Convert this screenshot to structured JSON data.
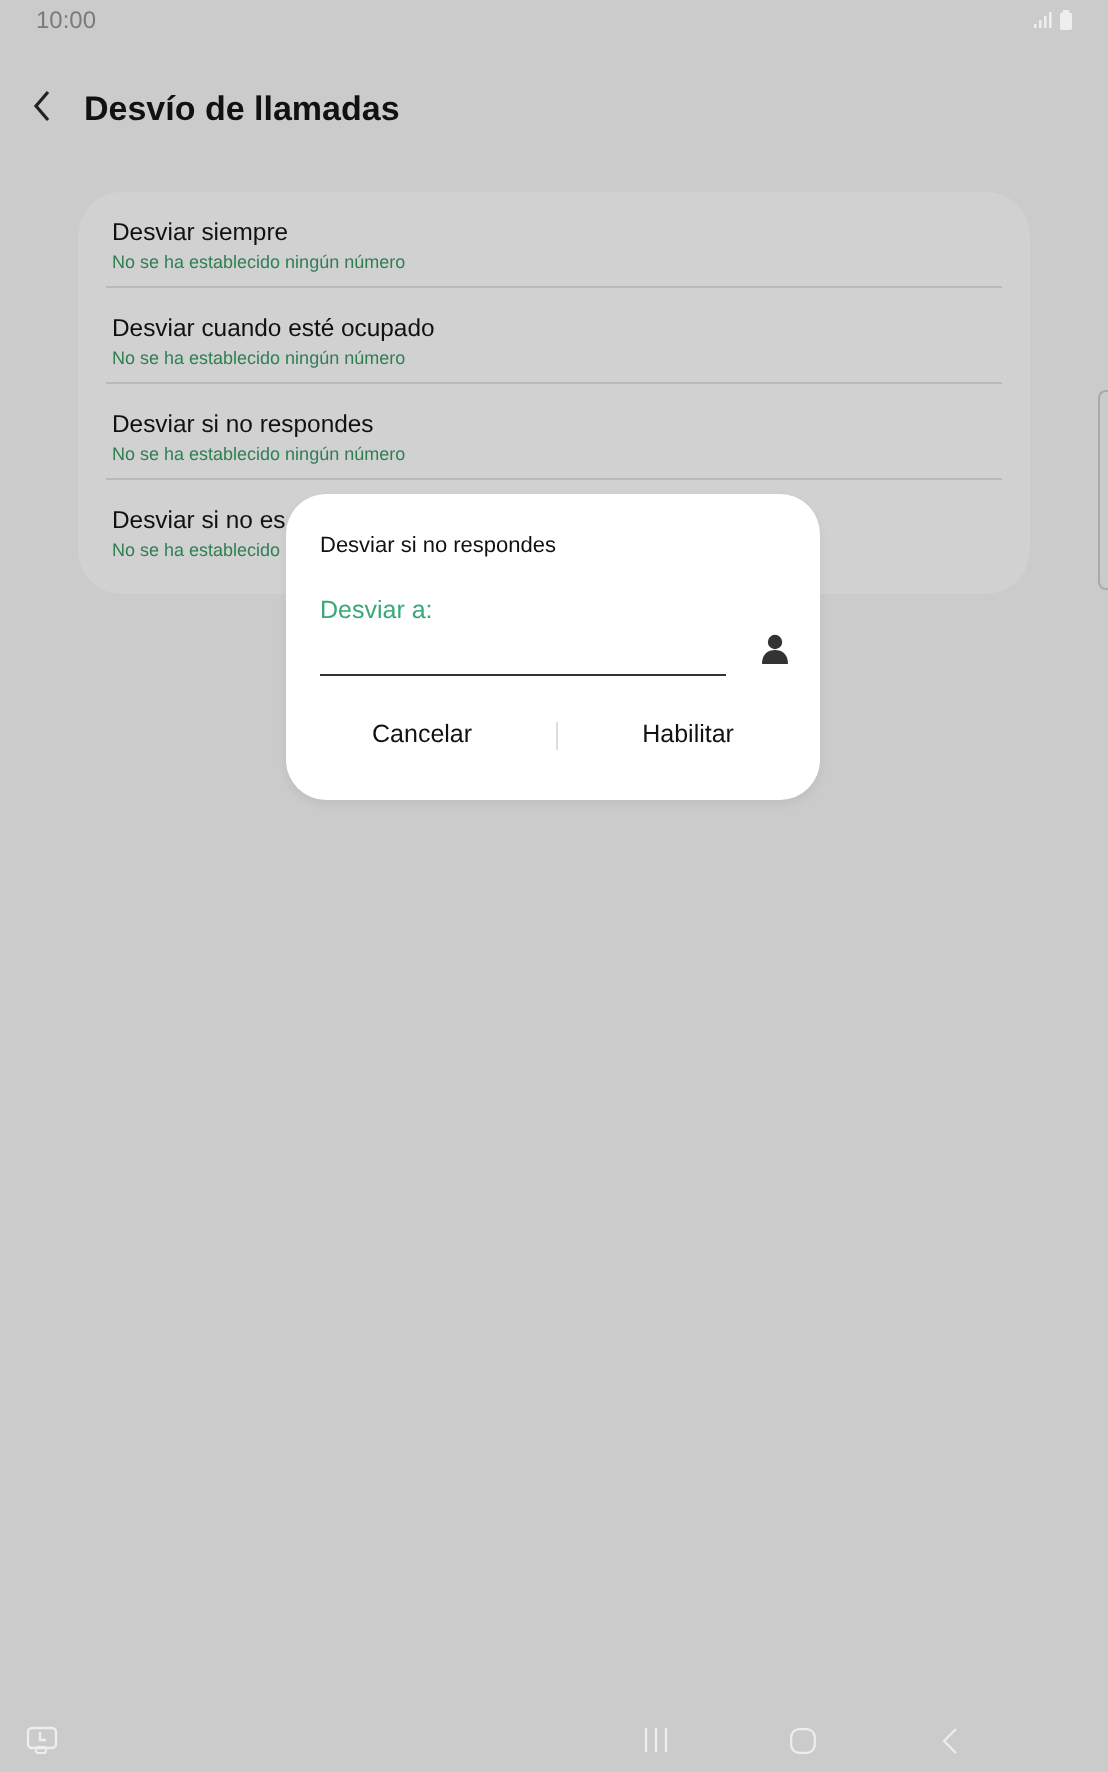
{
  "status_bar": {
    "time": "10:00"
  },
  "header": {
    "title": "Desvío de llamadas"
  },
  "items": [
    {
      "title": "Desviar siempre",
      "subtitle": "No se ha establecido ningún número"
    },
    {
      "title": "Desviar cuando esté ocupado",
      "subtitle": "No se ha establecido ningún número"
    },
    {
      "title": "Desviar si no respondes",
      "subtitle": "No se ha establecido ningún número"
    },
    {
      "title": "Desviar si no es",
      "subtitle": "No se ha establecido"
    }
  ],
  "dialog": {
    "title": "Desviar si no respondes",
    "field_label": "Desviar a:",
    "buttons": [
      "Cancelar",
      "Habilitar"
    ]
  }
}
